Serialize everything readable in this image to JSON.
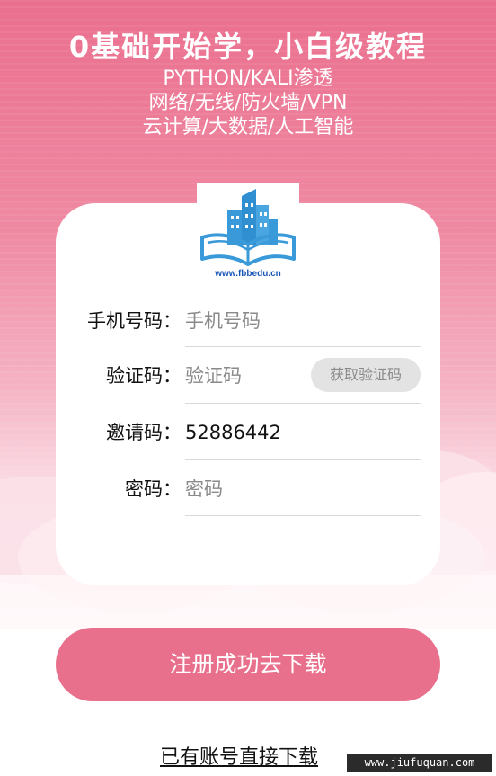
{
  "hero": {
    "title": "0基础开始学，小白级教程",
    "line1": "PYTHON/KALI渗透",
    "line2": "网络/无线/防火墙/VPN",
    "line3": "云计算/大数据/人工智能"
  },
  "logo": {
    "url_text": "www.fbbedu.cn",
    "icon": "book-city-logo-icon"
  },
  "form": {
    "phone_label": "手机号码：",
    "phone_placeholder": "手机号码",
    "code_label": "验证码：",
    "code_placeholder": "验证码",
    "get_code_button": "获取验证码",
    "invite_label": "邀请码：",
    "invite_value": "52886442",
    "password_label": "密码：",
    "password_placeholder": "密码"
  },
  "actions": {
    "submit_label": "注册成功去下载",
    "login_link": "已有账号直接下载"
  },
  "watermark": "www.jiufuquan.com",
  "colors": {
    "accent": "#e8708d",
    "logo_blue": "#3a9ad9",
    "url_blue": "#1a56b8"
  }
}
